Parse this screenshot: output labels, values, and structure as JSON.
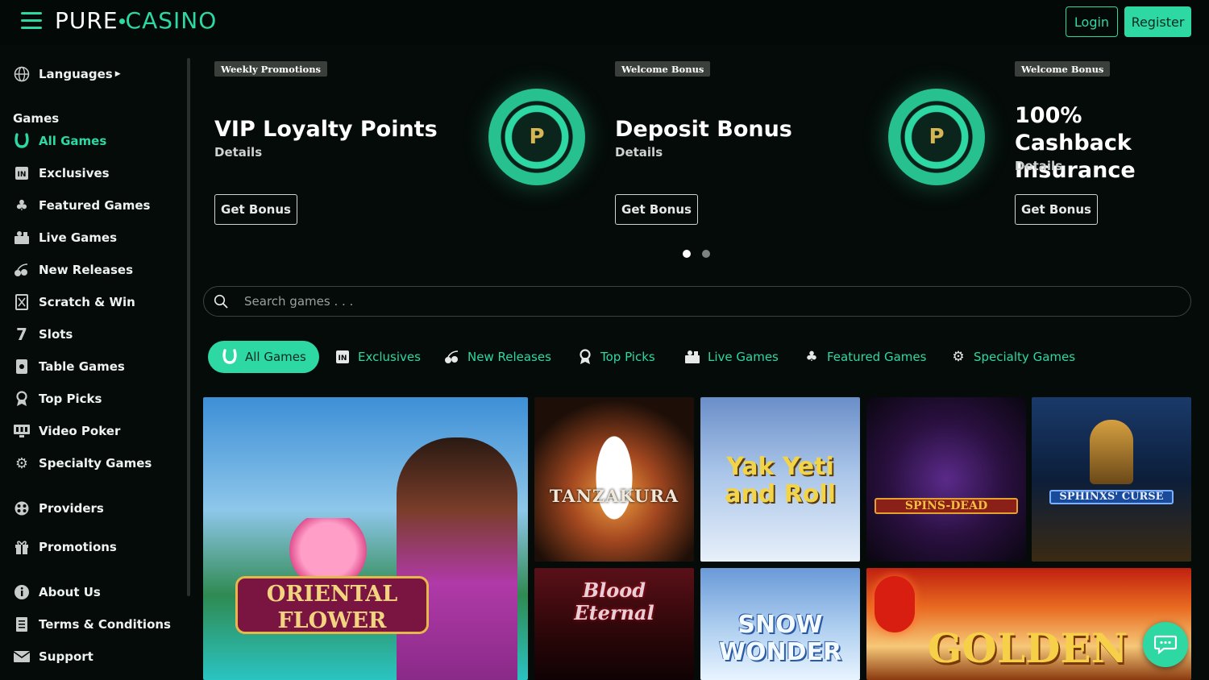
{
  "header": {
    "logo_part1": "PURE",
    "logo_part2": "CASINO",
    "login_label": "Login",
    "register_label": "Register"
  },
  "sidebar": {
    "languages_label": "Languages",
    "games_heading": "Games",
    "items": [
      {
        "label": "All Games",
        "icon": "horseshoe-icon",
        "active": true
      },
      {
        "label": "Exclusives",
        "icon": "exclusive-badge-icon"
      },
      {
        "label": "Featured Games",
        "icon": "clover-icon"
      },
      {
        "label": "Live Games",
        "icon": "live-dealer-icon"
      },
      {
        "label": "New Releases",
        "icon": "cherries-icon"
      },
      {
        "label": "Scratch & Win",
        "icon": "scratch-card-icon"
      },
      {
        "label": "Slots",
        "icon": "seven-icon"
      },
      {
        "label": "Table Games",
        "icon": "cards-icon"
      },
      {
        "label": "Top Picks",
        "icon": "award-icon"
      },
      {
        "label": "Video Poker",
        "icon": "video-poker-icon"
      },
      {
        "label": "Specialty Games",
        "icon": "gear-icon"
      }
    ],
    "providers_label": "Providers",
    "promotions_label": "Promotions",
    "about_label": "About Us",
    "terms_label": "Terms & Conditions",
    "support_label": "Support"
  },
  "promos": [
    {
      "tag": "Weekly Promotions",
      "title": "VIP Loyalty Points",
      "details": "Details",
      "button": "Get Bonus"
    },
    {
      "tag": "Welcome Bonus",
      "title": "Deposit Bonus",
      "details": "Details",
      "button": "Get Bonus"
    },
    {
      "tag": "Welcome Bonus",
      "title": "100% Cashback Insurance",
      "details": "Details",
      "button": "Get Bonus"
    }
  ],
  "carousel": {
    "pages": 2,
    "current": 1
  },
  "search": {
    "placeholder": "Search games . . ."
  },
  "tabs": [
    {
      "label": "All Games",
      "icon": "horseshoe-icon",
      "active": true
    },
    {
      "label": "Exclusives",
      "icon": "exclusive-badge-icon"
    },
    {
      "label": "New Releases",
      "icon": "cherries-icon"
    },
    {
      "label": "Top Picks",
      "icon": "award-icon"
    },
    {
      "label": "Live Games",
      "icon": "live-dealer-icon"
    },
    {
      "label": "Featured Games",
      "icon": "clover-icon"
    },
    {
      "label": "Specialty Games",
      "icon": "gear-icon"
    }
  ],
  "games": [
    {
      "title": "ORIENTAL FLOWER"
    },
    {
      "title": "TANZAKURA"
    },
    {
      "title": "Yak Yeti and Roll"
    },
    {
      "title": "SPINS-DEAD"
    },
    {
      "title": "SPHINXS' CURSE"
    },
    {
      "title": "Blood Eternal"
    },
    {
      "title": "SNOW WONDER"
    },
    {
      "title": "GOLDEN"
    }
  ],
  "colors": {
    "accent": "#2ed8a3",
    "background": "#050b08"
  }
}
